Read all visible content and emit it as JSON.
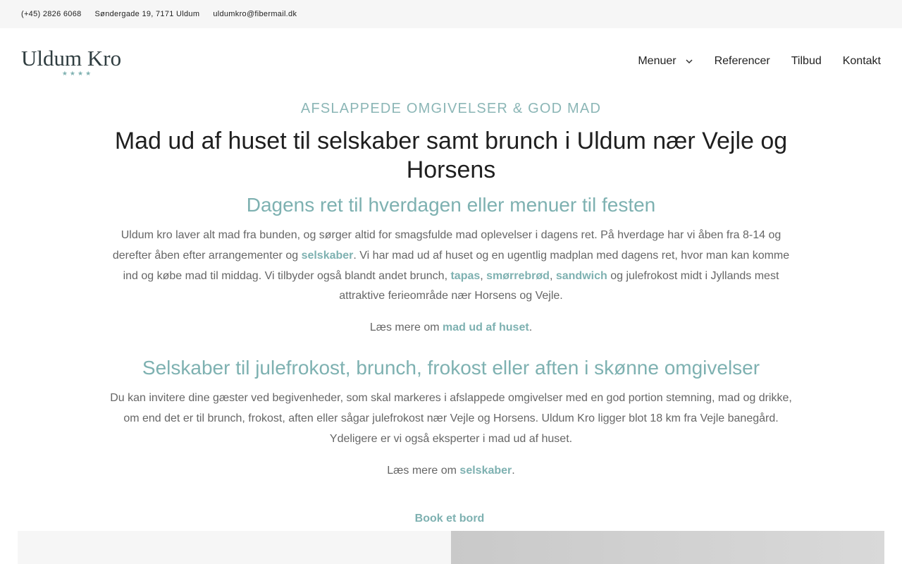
{
  "topbar": {
    "phone": "(+45) 2826 6068",
    "address": "Søndergade 19, 7171 Uldum",
    "email": "uldumkro@fibermail.dk"
  },
  "header": {
    "logo_text": "Uldum Kro",
    "logo_stars": "★★★★",
    "nav": {
      "menuer": "Menuer",
      "referencer": "Referencer",
      "tilbud": "Tilbud",
      "kontakt": "Kontakt"
    },
    "chevron_icon": "chevron-down-icon"
  },
  "main": {
    "eyebrow": "AFSLAPPEDE OMGIVELSER & GOD MAD",
    "title": "Mad ud af huset til selskaber samt brunch i Uldum nær Vejle og Horsens",
    "section1": {
      "heading": "Dagens ret til hverdagen eller menuer til festen",
      "p_a": "Uldum kro laver alt mad fra bunden, og sørger altid for smagsfulde mad oplevelser i dagens ret. På hverdage har vi åben fra 8-14 og derefter åben efter arrangementer og ",
      "link_selskaber": "selskaber",
      "p_b": ". Vi har mad ud af huset og en ugentlig madplan med dagens ret, hvor man kan komme ind og købe mad til middag. Vi tilbyder også blandt andet brunch, ",
      "link_tapas": "tapas",
      "sep1": ", ",
      "link_smorrebrod": "smørrebrød",
      "sep2": ", ",
      "link_sandwich": "sandwich",
      "p_c": " og julefrokost midt i Jyllands mest attraktive ferieområde nær Horsens og Vejle.",
      "readmore_prefix": "Læs mere om ",
      "readmore_link": "mad ud af huset",
      "readmore_suffix": "."
    },
    "section2": {
      "heading": "Selskaber til julefrokost, brunch, frokost eller aften i skønne omgivelser",
      "para": "Du kan invitere dine gæster ved begivenheder, som skal markeres i afslappede omgivelser med en god portion stemning, mad og drikke, om end det er til brunch, frokost, aften eller sågar julefrokost nær Vejle og Horsens. Uldum Kro ligger blot 18 km fra Vejle banegård. Ydeligere er vi også eksperter i mad ud af huset.",
      "readmore_prefix": "Læs mere om ",
      "readmore_link": "selskaber",
      "readmore_suffix": "."
    }
  },
  "bottom": {
    "book_label": "Book et bord"
  },
  "colors": {
    "accent": "#7eb1b1",
    "text": "#666666",
    "heading": "#1f1f1f",
    "topbar_bg": "#f6f6f6"
  }
}
